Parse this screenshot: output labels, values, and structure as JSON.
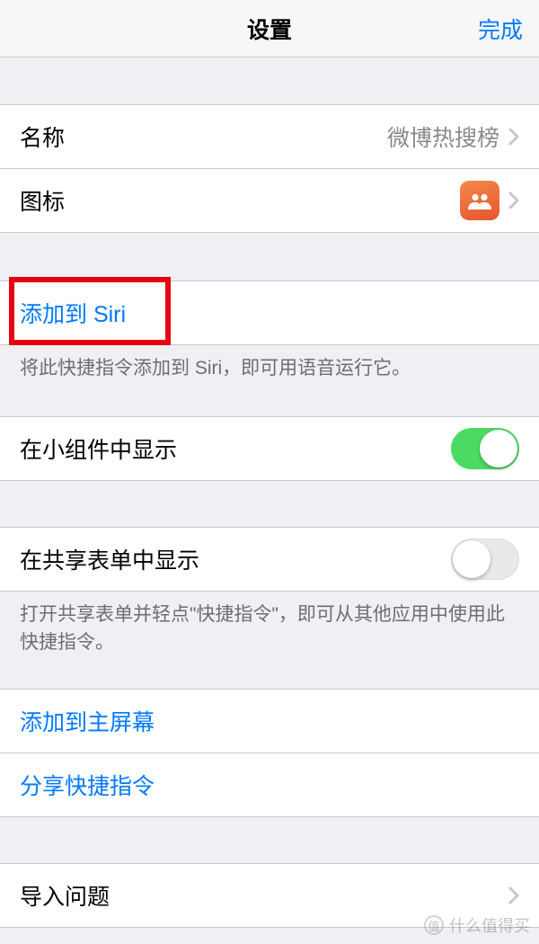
{
  "header": {
    "title": "设置",
    "done": "完成"
  },
  "name_row": {
    "label": "名称",
    "value": "微博热搜榜"
  },
  "icon_row": {
    "label": "图标"
  },
  "siri": {
    "label": "添加到 Siri",
    "footer": "将此快捷指令添加到 Siri，即可用语音运行它。"
  },
  "widget": {
    "label": "在小组件中显示",
    "on": true
  },
  "share_sheet": {
    "label": "在共享表单中显示",
    "on": false,
    "footer": "打开共享表单并轻点\"快捷指令\"，即可从其他应用中使用此快捷指令。"
  },
  "actions": {
    "home": "添加到主屏幕",
    "share": "分享快捷指令"
  },
  "import_q": {
    "label": "导入问题"
  },
  "watermark": {
    "symbol": "值",
    "text": "什么值得买"
  }
}
